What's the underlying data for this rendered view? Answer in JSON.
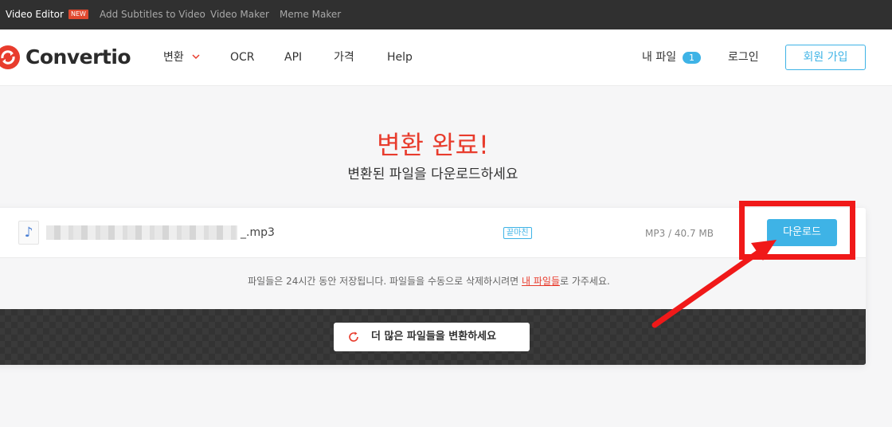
{
  "topbar": {
    "items": [
      {
        "label": "Video Editor",
        "badge": "NEW",
        "active": true
      },
      {
        "label": "Add Subtitles to Video"
      },
      {
        "label": "Video Maker"
      },
      {
        "label": "Meme Maker"
      }
    ]
  },
  "header": {
    "logo": "Convertio",
    "nav": [
      "변환",
      "OCR",
      "API",
      "가격",
      "Help"
    ],
    "my_files_label": "내 파일",
    "my_files_count": "1",
    "login": "로그인",
    "signup": "회원 가입"
  },
  "hero": {
    "title": "변환 완료!",
    "subtitle": "변환된 파일을 다운로드하세요"
  },
  "file": {
    "icon": "music-note-icon",
    "name_visible": "_.mp3",
    "status": "끝마친",
    "size": "MP3 / 40.7 MB",
    "download": "다운로드"
  },
  "notice": {
    "before": "파일들은 24시간 동안 저장됩니다. 파일들을 수동으로 삭제하시려면 ",
    "link": "내 파일들",
    "after": "로 가주세요."
  },
  "convert_more": {
    "label": "더 많은 파일들을 변환하세요",
    "icon": "refresh-icon"
  },
  "colors": {
    "brand_red": "#e83c2d",
    "accent_blue": "#3eb3e6",
    "annotation_red": "#f01919"
  }
}
